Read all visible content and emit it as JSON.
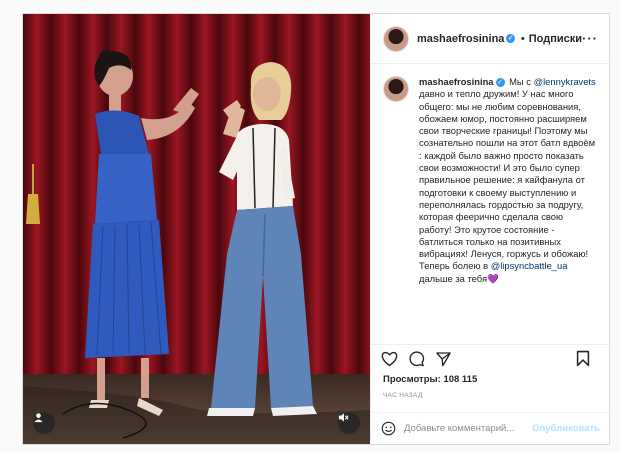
{
  "post": {
    "username": "mashaefrosinina",
    "header_follow": "Подписки",
    "header_dot": "•",
    "more_icon": "more-horizontal-icon",
    "caption": {
      "line1_rest": " Мы с",
      "mention1": "@lennykravets",
      "body1": " давно и тепло дружим! У нас много общего: мы не любим соревнования, обожаем юмор, постоянно расширяем свои творческие границы! Поэтому мы сознательно пошли на этот батл вдвоём : каждой было важно просто показать свои возможности! И это было супер правильное решение: я кайфанула от подготовки к своему выступлению и переполнялась гордостью за подругу, которая феерично сделала свою работу! Это крутое состояние - батлиться только на позитивных вибрациях! Ленуся, горжусь и обожаю! Теперь болею в ",
      "mention2": "@lipsyncbattle_ua",
      "body2": " дальше за тебя",
      "emoji": "💜"
    },
    "views_label": "Просмотры:",
    "views_count": "108 115",
    "time_ago": "ЧАС НАЗАД",
    "comment_placeholder": "Добавьте комментарий...",
    "publish_label": "Опубликовать",
    "colors": {
      "verified": "#3897f0",
      "link": "#00376b",
      "publish_disabled": "#b2dffc",
      "curtain": "#7a1018"
    }
  }
}
